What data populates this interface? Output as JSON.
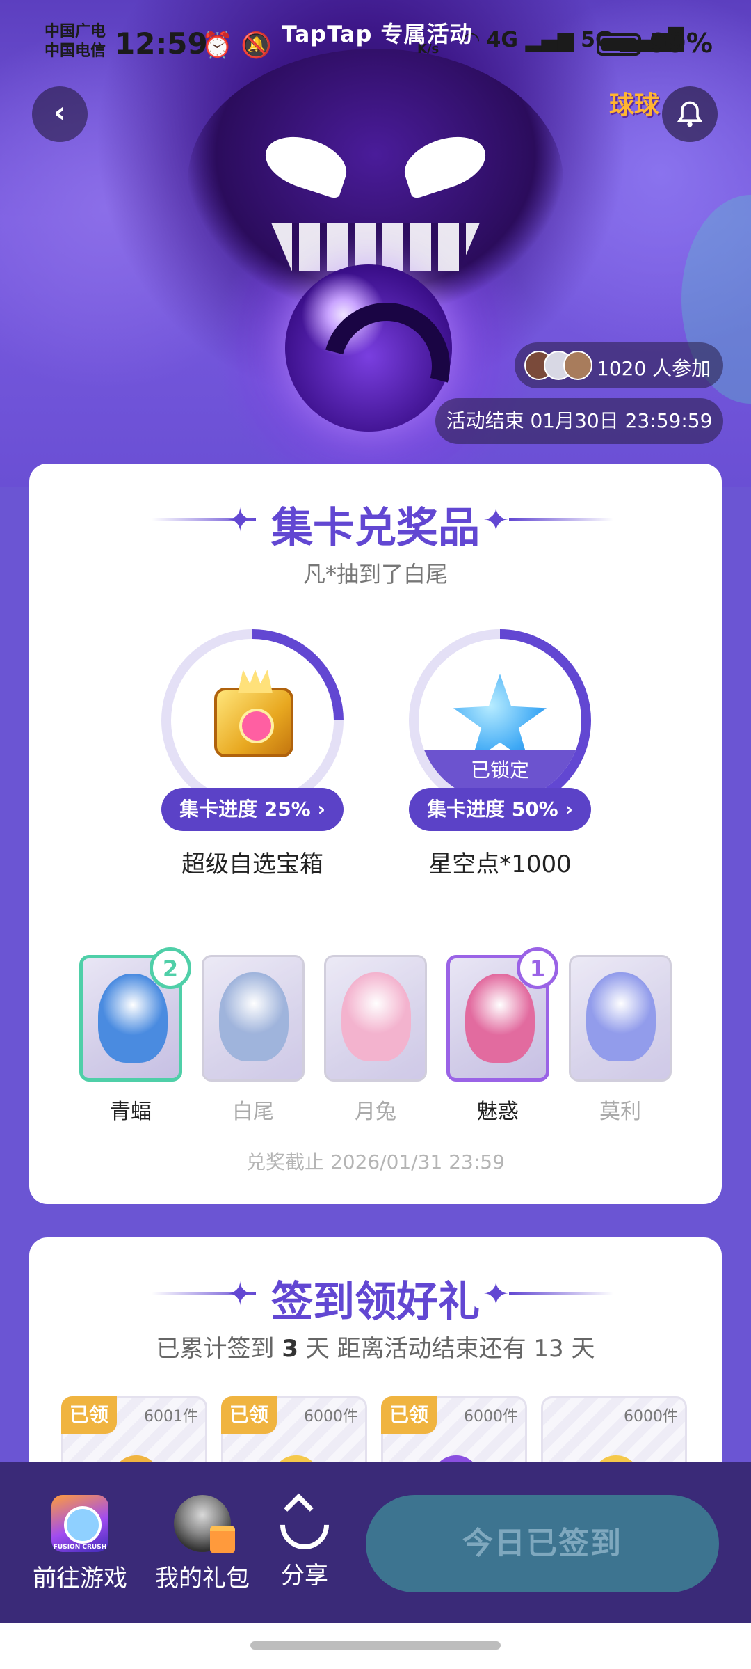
{
  "status_bar": {
    "carrier_1": "中国广电",
    "carrier_2": "中国电信",
    "time": "12:59",
    "net_speed": "K/s",
    "network_1": "4G",
    "network_2": "5G",
    "battery": "99%",
    "battery_level": 0.99
  },
  "header": {
    "title": "TapTap 专属活动",
    "game_logo_text": "球球",
    "participants": "1020 人参加",
    "event_end": "活动结束 01月30日 23:59:59"
  },
  "collect": {
    "title": "集卡兑奖品",
    "ticker": "凡*抽到了白尾",
    "prizes": [
      {
        "name": "超级自选宝箱",
        "progress_label": "集卡进度 25% ›",
        "progress": 25,
        "locked": false,
        "locked_label": ""
      },
      {
        "name": "星空点*1000",
        "progress_label": "集卡进度 50% ›",
        "progress": 50,
        "locked": true,
        "locked_label": "已锁定"
      }
    ],
    "cards": [
      {
        "name": "青蝠",
        "count": "2",
        "owned": true,
        "accent": "#4fcfa8",
        "art_color": "#4a8be0"
      },
      {
        "name": "白尾",
        "count": "",
        "owned": false,
        "accent": "",
        "art_color": "#8fa7d6"
      },
      {
        "name": "月兔",
        "count": "",
        "owned": false,
        "accent": "",
        "art_color": "#f2a6c6"
      },
      {
        "name": "魅惑",
        "count": "1",
        "owned": true,
        "accent": "#9a63e6",
        "art_color": "#e26b9f"
      },
      {
        "name": "莫利",
        "count": "",
        "owned": false,
        "accent": "",
        "art_color": "#7f8be8"
      }
    ],
    "deadline": "兑奖截止 2026/01/31 23:59"
  },
  "signin": {
    "title": "签到领好礼",
    "info_prefix": "已累计签到 ",
    "days": "3",
    "info_suffix": " 天  距离活动结束还有 13 天",
    "tiles": [
      {
        "tag": "已领",
        "count": "6001件",
        "thumb_color": "#f0b440"
      },
      {
        "tag": "已领",
        "count": "6000件",
        "thumb_color": "#f5c84a"
      },
      {
        "tag": "已领",
        "count": "6000件",
        "thumb_color": "#8a4fe0"
      },
      {
        "tag": "",
        "count": "6000件",
        "thumb_color": "#f5c84a"
      }
    ]
  },
  "bottom_bar": {
    "go_game": "前往游戏",
    "game_icon_text": "FUSION CRUSH",
    "my_gifts": "我的礼包",
    "share": "分享",
    "signed_today": "今日已签到"
  },
  "colors": {
    "primary": "#6247d2",
    "background": "#6b55d3",
    "bottom_bar": "#3a2a78",
    "signed_button": "#3d7490"
  }
}
